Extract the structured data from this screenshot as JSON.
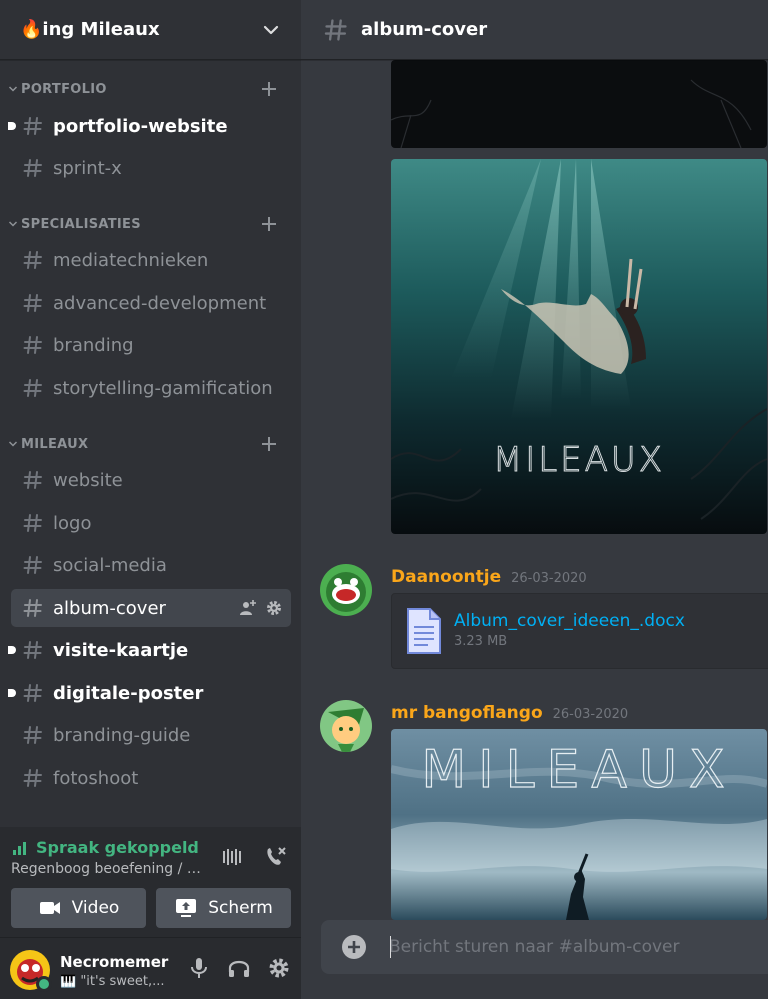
{
  "server": {
    "name": "🔥ing Mileaux"
  },
  "categories": [
    {
      "label": "PORTFOLIO",
      "channels": [
        {
          "name": "portfolio-website"
        },
        {
          "name": "sprint-x"
        }
      ]
    },
    {
      "label": "SPECIALISATIES",
      "channels": [
        {
          "name": "mediatechnieken"
        },
        {
          "name": "advanced-development"
        },
        {
          "name": "branding"
        },
        {
          "name": "storytelling-gamification"
        }
      ]
    },
    {
      "label": "MILEAUX",
      "channels": [
        {
          "name": "website"
        },
        {
          "name": "logo"
        },
        {
          "name": "social-media"
        },
        {
          "name": "album-cover"
        },
        {
          "name": "visite-kaartje"
        },
        {
          "name": "digitale-poster"
        },
        {
          "name": "branding-guide"
        },
        {
          "name": "fotoshoot"
        }
      ]
    }
  ],
  "voice": {
    "status": "Spraak gekoppeld",
    "channel": "Regenboog beoefening / 🔥...",
    "video_label": "Video",
    "screen_label": "Scherm"
  },
  "user": {
    "name": "Necromemer",
    "status": "🎹 \"it's sweet,..."
  },
  "main": {
    "channel_title": "album-cover",
    "album_cover_text": "MILEAUX",
    "messages": [
      {
        "author": "Daanoontje",
        "time": "26-03-2020",
        "file": {
          "name": "Album_cover_ideeen_.docx",
          "size": "3.23 MB"
        }
      },
      {
        "author": "mr bangoflango",
        "time": "26-03-2020",
        "image_text": "MILEAUX"
      }
    ],
    "composer_placeholder": "Bericht sturen naar #album-cover"
  },
  "colors": {
    "sidebar": "#2f3136",
    "main": "#36393f",
    "panel": "#292b2f",
    "online_green": "#43b581",
    "author_orange": "#faa61a",
    "link_blue": "#00b0f4"
  },
  "icons": [
    "chevron-down-icon",
    "plus-icon",
    "hash-icon",
    "add-member-icon",
    "gear-icon",
    "signal-icon",
    "soundboard-icon",
    "disconnect-icon",
    "video-icon",
    "screen-share-icon",
    "microphone-icon",
    "headphones-icon",
    "settings-icon",
    "file-icon"
  ]
}
